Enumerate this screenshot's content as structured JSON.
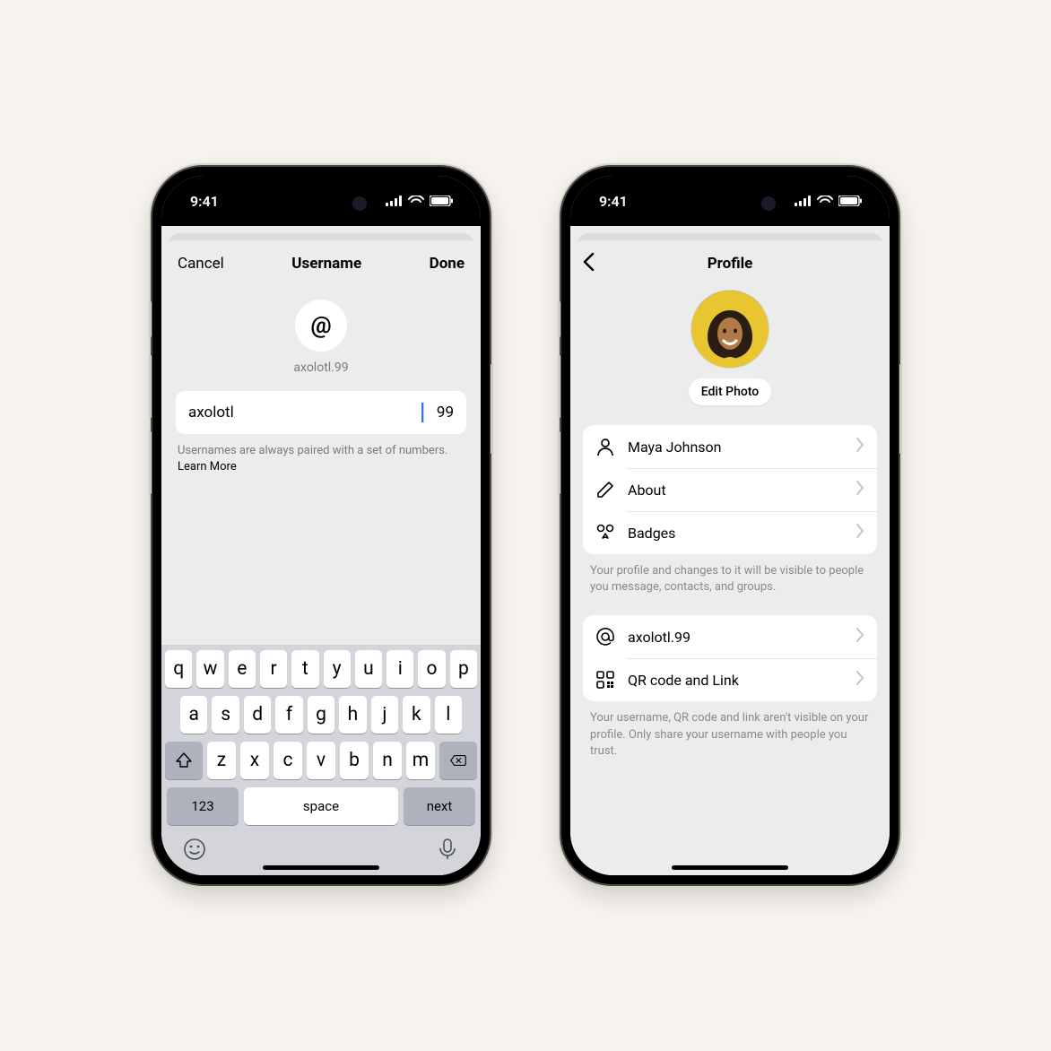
{
  "status": {
    "time": "9:41"
  },
  "left": {
    "header": {
      "cancel": "Cancel",
      "title": "Username",
      "done": "Done"
    },
    "username_display": "axolotl.99",
    "input_value": "axolotl",
    "input_suffix": "99",
    "helper_text": "Usernames are always paired with a set of numbers.",
    "learn_more": "Learn More",
    "keyboard": {
      "row1": [
        "q",
        "w",
        "e",
        "r",
        "t",
        "y",
        "u",
        "i",
        "o",
        "p"
      ],
      "row2": [
        "a",
        "s",
        "d",
        "f",
        "g",
        "h",
        "j",
        "k",
        "l"
      ],
      "row3": [
        "z",
        "x",
        "c",
        "v",
        "b",
        "n",
        "m"
      ],
      "num_key": "123",
      "space_key": "space",
      "next_key": "next"
    }
  },
  "right": {
    "title": "Profile",
    "edit_photo": "Edit Photo",
    "rows1": [
      {
        "icon": "person-icon",
        "label": "Maya Johnson"
      },
      {
        "icon": "pencil-icon",
        "label": "About"
      },
      {
        "icon": "badges-icon",
        "label": "Badges"
      }
    ],
    "note1": "Your profile and changes to it will be visible to people you message, contacts, and groups.",
    "rows2": [
      {
        "icon": "at-icon",
        "label": "axolotl.99"
      },
      {
        "icon": "qr-icon",
        "label": "QR code and Link"
      }
    ],
    "note2": "Your username, QR code and link aren't visible on your profile. Only share your username with people you trust."
  }
}
